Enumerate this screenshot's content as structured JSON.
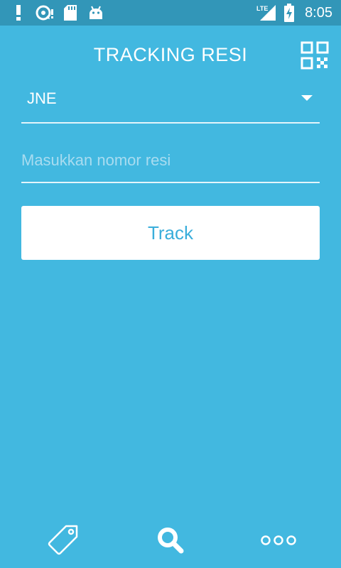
{
  "status_bar": {
    "time": "8:05",
    "network": "LTE",
    "icons": [
      "alert-icon",
      "sync-icon",
      "sd-card-icon",
      "android-icon",
      "signal-icon",
      "battery-charging-icon"
    ]
  },
  "header": {
    "title": "TRACKING RESI",
    "qr_icon": "qr-code-icon"
  },
  "form": {
    "courier": {
      "selected": "JNE"
    },
    "resi": {
      "value": "",
      "placeholder": "Masukkan nomor resi"
    },
    "track_label": "Track"
  },
  "bottom_nav": {
    "items": [
      {
        "icon": "tag-icon",
        "active": false
      },
      {
        "icon": "search-icon",
        "active": true
      },
      {
        "icon": "more-icon",
        "active": false
      }
    ]
  },
  "colors": {
    "background": "#42b8e0",
    "status_bar": "#3296b8",
    "accent": "#3aaedb",
    "text": "#ffffff"
  }
}
